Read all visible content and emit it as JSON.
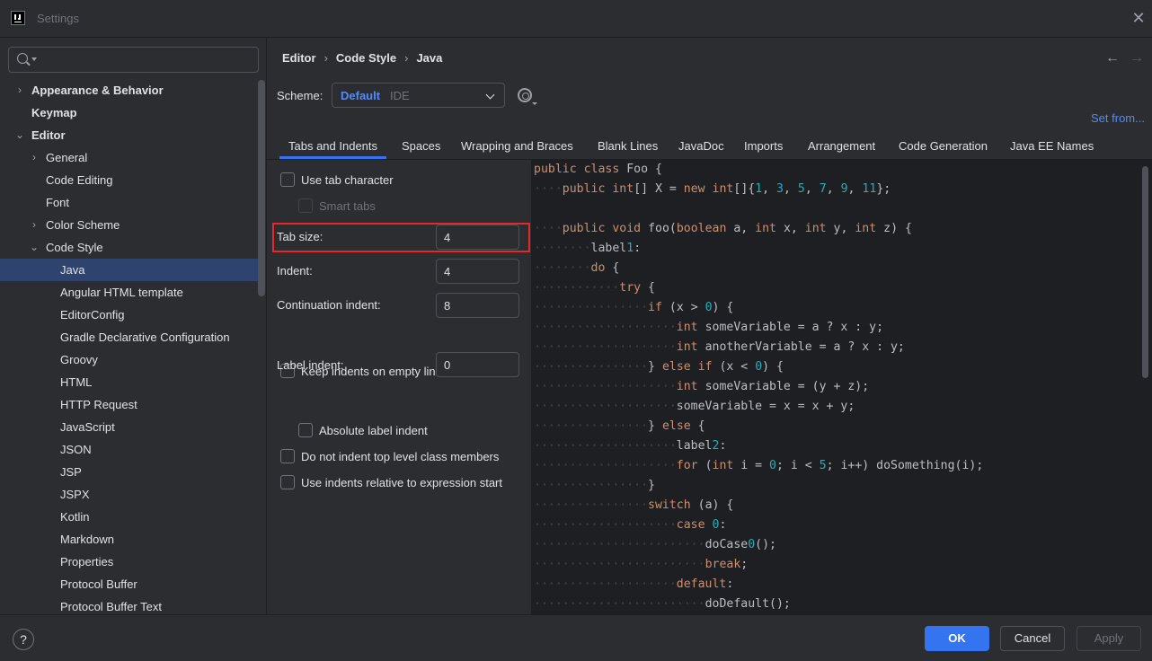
{
  "window": {
    "title": "Settings"
  },
  "search": {
    "placeholder": "",
    "value": ""
  },
  "sidebar": {
    "items": [
      {
        "label": "Appearance & Behavior",
        "level": 0,
        "chevron": ">",
        "bold": true,
        "selected": false
      },
      {
        "label": "Keymap",
        "level": 0,
        "chevron": "",
        "bold": true,
        "selected": false
      },
      {
        "label": "Editor",
        "level": 0,
        "chevron": "v",
        "bold": true,
        "selected": false
      },
      {
        "label": "General",
        "level": 1,
        "chevron": ">",
        "bold": false,
        "selected": false
      },
      {
        "label": "Code Editing",
        "level": 1,
        "chevron": "",
        "bold": false,
        "selected": false
      },
      {
        "label": "Font",
        "level": 1,
        "chevron": "",
        "bold": false,
        "selected": false
      },
      {
        "label": "Color Scheme",
        "level": 1,
        "chevron": ">",
        "bold": false,
        "selected": false
      },
      {
        "label": "Code Style",
        "level": 1,
        "chevron": "v",
        "bold": false,
        "selected": false
      },
      {
        "label": "Java",
        "level": 2,
        "chevron": "",
        "bold": false,
        "selected": true
      },
      {
        "label": "Angular HTML template",
        "level": 2,
        "chevron": "",
        "bold": false,
        "selected": false
      },
      {
        "label": "EditorConfig",
        "level": 2,
        "chevron": "",
        "bold": false,
        "selected": false
      },
      {
        "label": "Gradle Declarative Configuration",
        "level": 2,
        "chevron": "",
        "bold": false,
        "selected": false
      },
      {
        "label": "Groovy",
        "level": 2,
        "chevron": "",
        "bold": false,
        "selected": false
      },
      {
        "label": "HTML",
        "level": 2,
        "chevron": "",
        "bold": false,
        "selected": false
      },
      {
        "label": "HTTP Request",
        "level": 2,
        "chevron": "",
        "bold": false,
        "selected": false
      },
      {
        "label": "JavaScript",
        "level": 2,
        "chevron": "",
        "bold": false,
        "selected": false
      },
      {
        "label": "JSON",
        "level": 2,
        "chevron": "",
        "bold": false,
        "selected": false
      },
      {
        "label": "JSP",
        "level": 2,
        "chevron": "",
        "bold": false,
        "selected": false
      },
      {
        "label": "JSPX",
        "level": 2,
        "chevron": "",
        "bold": false,
        "selected": false
      },
      {
        "label": "Kotlin",
        "level": 2,
        "chevron": "",
        "bold": false,
        "selected": false
      },
      {
        "label": "Markdown",
        "level": 2,
        "chevron": "",
        "bold": false,
        "selected": false
      },
      {
        "label": "Properties",
        "level": 2,
        "chevron": "",
        "bold": false,
        "selected": false
      },
      {
        "label": "Protocol Buffer",
        "level": 2,
        "chevron": "",
        "bold": false,
        "selected": false
      },
      {
        "label": "Protocol Buffer Text",
        "level": 2,
        "chevron": "",
        "bold": false,
        "selected": false
      }
    ]
  },
  "breadcrumb": {
    "items": [
      "Editor",
      "Code Style",
      "Java"
    ],
    "separator": "›"
  },
  "nav": {
    "back": "←",
    "forward": "→"
  },
  "scheme": {
    "label": "Scheme:",
    "value": "Default",
    "sub": "IDE"
  },
  "set_from": "Set from...",
  "tabs": [
    {
      "label": "Tabs and Indents",
      "active": true
    },
    {
      "label": "Spaces",
      "active": false
    },
    {
      "label": "Wrapping and Braces",
      "active": false
    },
    {
      "label": "Blank Lines",
      "active": false
    },
    {
      "label": "JavaDoc",
      "active": false
    },
    {
      "label": "Imports",
      "active": false
    },
    {
      "label": "Arrangement",
      "active": false
    },
    {
      "label": "Code Generation",
      "active": false
    },
    {
      "label": "Java EE Names",
      "active": false
    }
  ],
  "options": {
    "use_tab_character": {
      "label": "Use tab character",
      "checked": false
    },
    "smart_tabs": {
      "label": "Smart tabs",
      "checked": false,
      "disabled": true
    },
    "tab_size": {
      "label": "Tab size:",
      "value": "4"
    },
    "indent": {
      "label": "Indent:",
      "value": "4"
    },
    "continuation_indent": {
      "label": "Continuation indent:",
      "value": "8"
    },
    "keep_indents": {
      "label": "Keep indents on empty lines",
      "checked": false
    },
    "label_indent": {
      "label": "Label indent:",
      "value": "0"
    },
    "absolute_label_indent": {
      "label": "Absolute label indent",
      "checked": false
    },
    "no_indent_top_level": {
      "label": "Do not indent top level class members",
      "checked": false
    },
    "relative_indents": {
      "label": "Use indents relative to expression start",
      "checked": false
    }
  },
  "code_preview": {
    "lines": [
      "public class Foo {",
      "····public int[] X = new int[]{1, 3, 5, 7, 9, 11};",
      "",
      "····public void foo(boolean a, int x, int y, int z) {",
      "········label1:",
      "········do {",
      "············try {",
      "················if (x > 0) {",
      "····················int someVariable = a ? x : y;",
      "····················int anotherVariable = a ? x : y;",
      "················} else if (x < 0) {",
      "····················int someVariable = (y + z);",
      "····················someVariable = x = x + y;",
      "················} else {",
      "····················label2:",
      "····················for (int i = 0; i < 5; i++) doSomething(i);",
      "················}",
      "················switch (a) {",
      "····················case 0:",
      "························doCase0();",
      "························break;",
      "····················default:",
      "························doDefault();"
    ]
  },
  "footer": {
    "help": "?",
    "ok": "OK",
    "cancel": "Cancel",
    "apply": "Apply"
  },
  "colors": {
    "accent": "#3574f0",
    "link": "#548af7",
    "selection": "#2e436e",
    "highlight_box": "#e5292b",
    "keyword": "#cf8e6d",
    "number": "#2aacb8"
  }
}
